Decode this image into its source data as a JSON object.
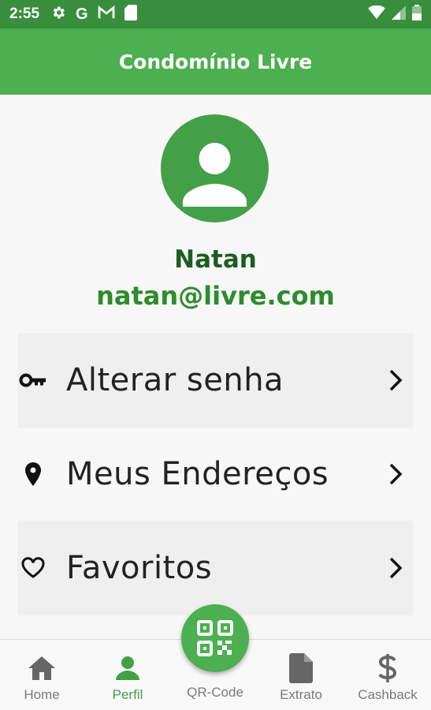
{
  "status_bar": {
    "time": "2:55",
    "left_icons": [
      "gear-icon",
      "google-g-icon",
      "gmail-icon",
      "sim-card-icon"
    ],
    "right_icons": [
      "wifi-icon",
      "signal-icon",
      "battery-icon"
    ]
  },
  "app_bar": {
    "title": "Condomínio Livre"
  },
  "profile": {
    "name": "Natan",
    "email": "natan@livre.com",
    "avatar_icon": "person-icon"
  },
  "menu": {
    "items": [
      {
        "label": "Alterar senha",
        "icon": "key-icon"
      },
      {
        "label": "Meus Endereços",
        "icon": "location-pin-icon"
      },
      {
        "label": "Favoritos",
        "icon": "heart-outline-icon"
      }
    ]
  },
  "bottom_nav": {
    "items": [
      {
        "label": "Home",
        "icon": "home-icon",
        "active": false
      },
      {
        "label": "Perfil",
        "icon": "person-icon",
        "active": true
      },
      {
        "label": "QR-Code",
        "icon": "qr-code-icon",
        "active": false
      },
      {
        "label": "Extrato",
        "icon": "document-icon",
        "active": false
      },
      {
        "label": "Cashback",
        "icon": "dollar-icon",
        "active": false
      }
    ]
  },
  "colors": {
    "primary": "#4caf50",
    "status_bar": "#388e3c",
    "name_text": "#1b5e20",
    "email_text": "#2e8b2e",
    "inactive_nav": "#7a7a7a"
  }
}
